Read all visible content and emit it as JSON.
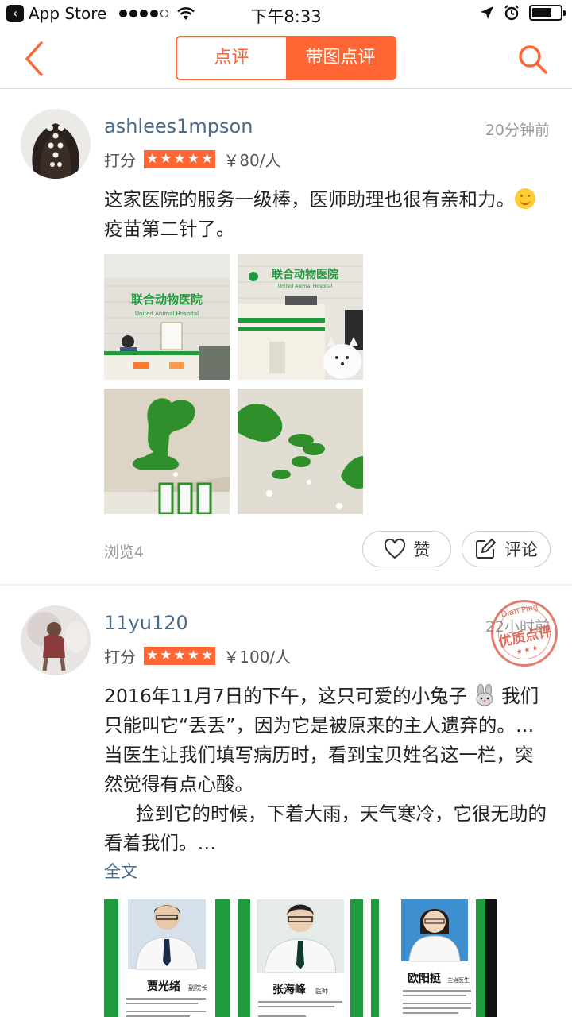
{
  "status_bar": {
    "back_app": "App Store",
    "time": "下午8:33"
  },
  "nav": {
    "tab_reviews": "点评",
    "tab_photo_reviews": "带图点评"
  },
  "reviews": [
    {
      "username": "ashlees1mpson",
      "time_ago": "20分钟前",
      "rating_label": "打分",
      "stars": 5,
      "price": "￥80/人",
      "text_1": "这家医院的服务一级棒，医师助理也很有亲和力。",
      "text_2": "疫苗第二针了。",
      "photo_signs": [
        "联合动物医院",
        "United Animal Hospital"
      ],
      "views": "浏览4",
      "like_label": "赞",
      "comment_label": "评论"
    },
    {
      "username": "11yu120",
      "time_ago": "22小时前",
      "rating_label": "打分",
      "stars": 5,
      "price": "￥100/人",
      "text_1": "2016年11月7日的下午，这只可爱的小兔子",
      "text_2": "我们只能叫它“丢丢”，因为它是被原来的主人遗弃的。…当医生让我们填写病历时，看到宝贝姓名这一栏，突然觉得有点心酸。",
      "text_3": "捡到它的时候，下着大雨，天气寒冷，它很无助的看着我们。…",
      "full_text_link": "全文",
      "stamp_en": "Dian Ping",
      "stamp_zh": "优质点评",
      "doctor_cards": [
        {
          "name": "贾光绪",
          "title": "副院长"
        },
        {
          "name": "张海峰",
          "title": "医师"
        },
        {
          "name": "欧阳挺",
          "title": "主治医生"
        }
      ]
    }
  ],
  "colors": {
    "accent": "#ff6633",
    "link": "#4a6a8a",
    "hospital_green": "#1f9a3c"
  }
}
